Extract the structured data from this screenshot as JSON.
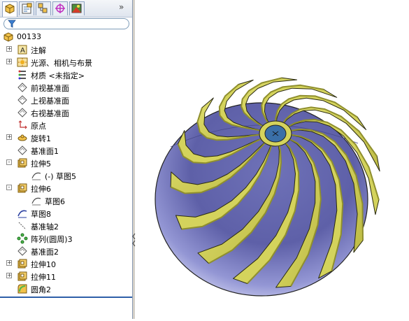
{
  "tabs": [
    {
      "name": "feature-manager-tab-icon",
      "active": true
    },
    {
      "name": "property-manager-tab-icon",
      "active": false
    },
    {
      "name": "configuration-manager-tab-icon",
      "active": false
    },
    {
      "name": "dimxpert-tab-icon",
      "active": false
    },
    {
      "name": "display-manager-tab-icon",
      "active": false
    }
  ],
  "overflow_glyph": "»",
  "tree": [
    {
      "label": "00133",
      "icon": "part-icon",
      "exp": ""
    },
    {
      "label": "注解",
      "icon": "annotations-icon",
      "exp": "+"
    },
    {
      "label": "光源、相机与布景",
      "icon": "lights-icon",
      "exp": "+"
    },
    {
      "label": "材质 <未指定>",
      "icon": "material-icon",
      "exp": ""
    },
    {
      "label": "前视基准面",
      "icon": "plane-icon",
      "exp": ""
    },
    {
      "label": "上视基准面",
      "icon": "plane-icon",
      "exp": ""
    },
    {
      "label": "右视基准面",
      "icon": "plane-icon",
      "exp": ""
    },
    {
      "label": "原点",
      "icon": "origin-icon",
      "exp": ""
    },
    {
      "label": "旋转1",
      "icon": "revolve-icon",
      "exp": "+"
    },
    {
      "label": "基准面1",
      "icon": "plane-icon",
      "exp": ""
    },
    {
      "label": "拉伸5",
      "icon": "extrude-icon",
      "exp": "-"
    },
    {
      "label": "(-) 草图5",
      "icon": "sketch-icon",
      "exp": ""
    },
    {
      "label": "拉伸6",
      "icon": "extrude-icon",
      "exp": "-"
    },
    {
      "label": "草图6",
      "icon": "sketch-icon",
      "exp": ""
    },
    {
      "label": "草图8",
      "icon": "sketch3d-icon",
      "exp": ""
    },
    {
      "label": "基准轴2",
      "icon": "axis-icon",
      "exp": ""
    },
    {
      "label": "阵列(圆周)3",
      "icon": "pattern-icon",
      "exp": ""
    },
    {
      "label": "基准面2",
      "icon": "plane-icon",
      "exp": ""
    },
    {
      "label": "拉伸10",
      "icon": "extrude-icon",
      "exp": "+"
    },
    {
      "label": "拉伸11",
      "icon": "extrude-icon",
      "exp": "+"
    },
    {
      "label": "圆角2",
      "icon": "fillet-icon",
      "exp": ""
    }
  ],
  "colors": {
    "blade": "#d4d35c",
    "blade_shade": "#8f8f2e",
    "hub": "#6f72b8",
    "hub_light": "#b9bce6",
    "axis": "#3a6fa8"
  }
}
